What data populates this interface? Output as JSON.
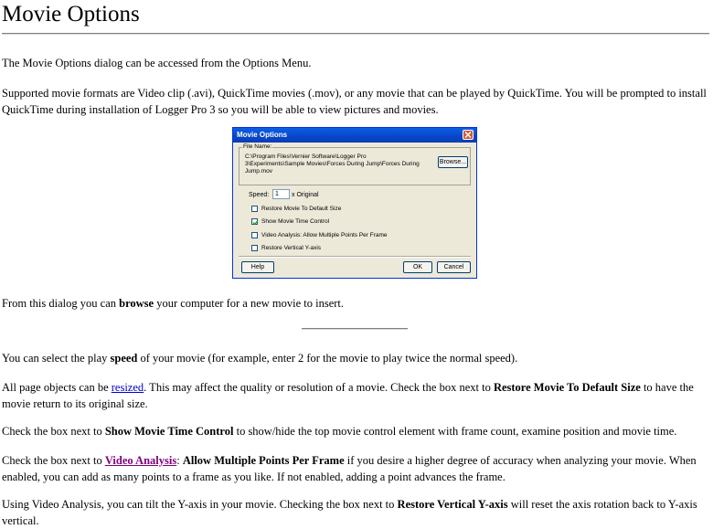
{
  "page": {
    "title": "Movie Options",
    "intro": "The Movie Options dialog can be accessed from the Options Menu.",
    "formats_line1": "Supported movie formats are Video clip (.avi), QuickTime movies (.mov), or any movie that can be played by QuickTime. You will be prompted to install",
    "formats_line2": "QuickTime during installation of Logger Pro 3 so you will be able to view pictures and movies.",
    "browse": {
      "pre": "From this dialog you can ",
      "bold": "browse",
      "post": " your computer for a new movie to insert."
    },
    "speed": {
      "pre": "You can select the play ",
      "bold": "speed",
      "post": " of your movie (for example, enter 2 for the movie to play twice the normal speed)."
    },
    "resize": {
      "pre": "All page objects can be ",
      "link": "resized",
      "mid": ". This may affect the quality or resolution of a movie. Check the box next to ",
      "bold": "Restore Movie To Default Size",
      "post": " to have the",
      "line2": "movie return to its original size."
    },
    "timecontrol": {
      "pre": "Check the box next to ",
      "bold": "Show Movie Time Control",
      "post": " to show/hide the top movie control element with frame count, examine position and movie time."
    },
    "videoanalysis": {
      "pre": "Check the box next to ",
      "link": "Video Analysis",
      "colon": ": ",
      "bold": "Allow Multiple Points Per Frame",
      "post": " if you desire a higher degree of accuracy when analyzing your movie. When",
      "line2": "enabled, you can add as many points to a frame as you like. If not enabled, adding a point advances the frame."
    },
    "yaxis": {
      "pre": "Using Video Analysis, you can tilt the Y-axis in your movie. Checking the box next to ",
      "bold": "Restore Vertical Y-axis",
      "post": " will reset the axis rotation back to Y-axis",
      "line2": "vertical."
    }
  },
  "dialog": {
    "title": "Movie Options",
    "file_name_label": "File Name:",
    "file_path_line1": "C:\\Program Files\\Vernier Software\\Logger Pro",
    "file_path_line2": "3\\Experiments\\Sample Movies\\Forces During Jump\\Forces During",
    "file_path_line3": "Jump.mov",
    "browse_button": "Browse...",
    "speed_label": "Speed:",
    "speed_value": "1",
    "speed_unit": "x Original",
    "checkboxes": [
      {
        "label": "Restore Movie To Default Size",
        "checked": false
      },
      {
        "label": "Show Movie Time Control",
        "checked": true
      },
      {
        "label": "Video Analysis: Allow Multiple Points Per Frame",
        "checked": false
      },
      {
        "label": "Restore Vertical Y-axis",
        "checked": false
      }
    ],
    "help_button": "Help",
    "ok_button": "OK",
    "cancel_button": "Cancel"
  },
  "colors": {
    "link": "#0000cc",
    "visited_link": "#800080",
    "dialog_title_bar": "#0846c8",
    "dialog_bg": "#ece9d8"
  }
}
